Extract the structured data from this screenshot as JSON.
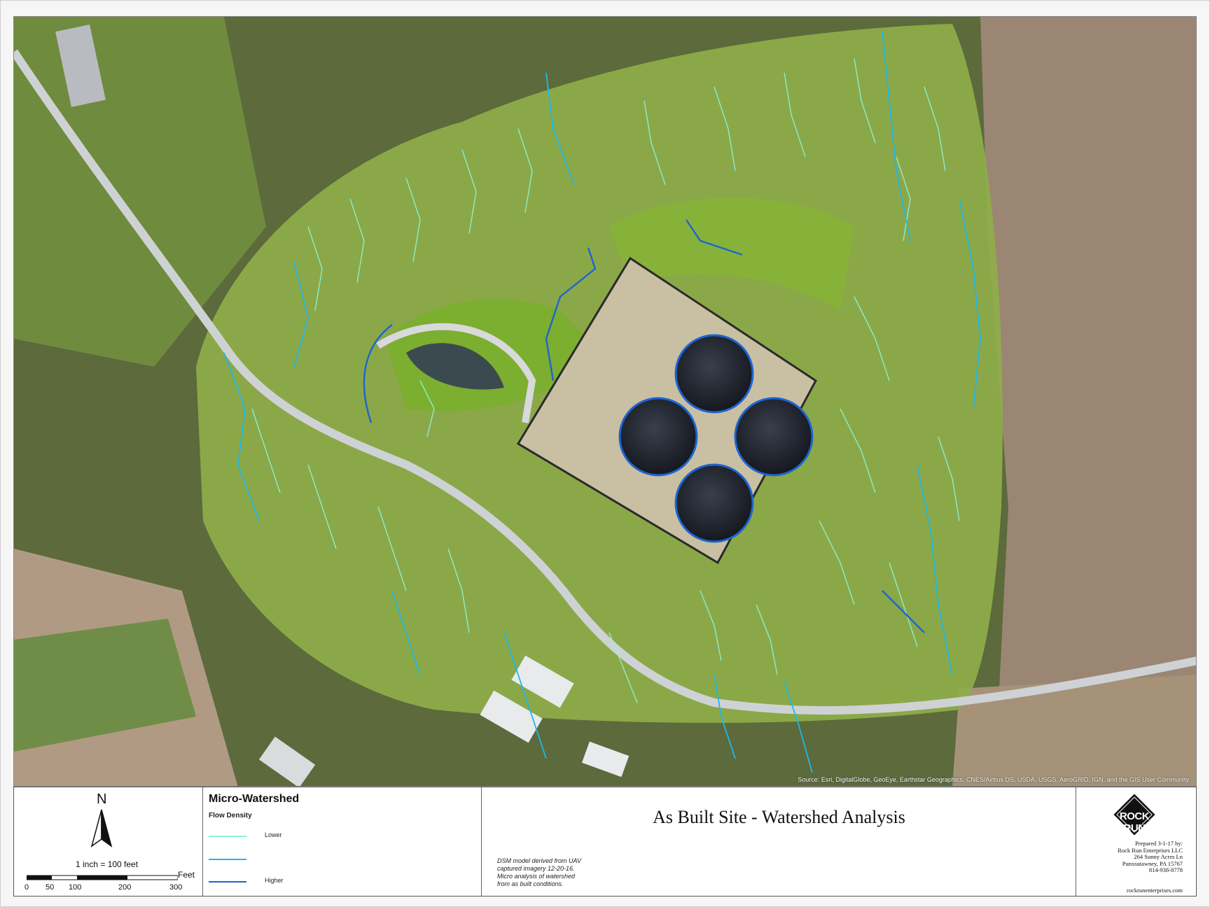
{
  "map": {
    "attribution": "Source: Esri, DigitalGlobe, GeoEye, Earthstar Geographics, CNES/Airbus DS, USDA, USGS, AeroGRID, IGN, and the GIS User Community",
    "colors": {
      "flow_lower": "#7fffd4",
      "flow_mid": "#1fb8e8",
      "flow_higher": "#1e64d2",
      "tank": "#20242e",
      "road": "#cfd2d4",
      "field": "#b8a694",
      "grass": "#7fa63c"
    }
  },
  "north_arrow": {
    "label": "N",
    "icon": "north-arrow-icon"
  },
  "scale": {
    "text": "1 inch = 100 feet",
    "unit": "Feet",
    "ticks": [
      "0",
      "50",
      "100",
      "200",
      "300"
    ]
  },
  "legend": {
    "title": "Micro-Watershed",
    "subtitle": "Flow Density",
    "items": [
      {
        "label": "Lower",
        "color": "#8af5da"
      },
      {
        "label": "",
        "color": "#1fb8e8"
      },
      {
        "label": "Higher",
        "color": "#1e64d2"
      }
    ]
  },
  "title_block": {
    "title": "As Built Site - Watershed Analysis",
    "note_line1": "DSM model derived from UAV",
    "note_line2": "captured imagery 12-20-16.",
    "note_line3": "Micro analysis of watershed",
    "note_line4": "from as built conditions."
  },
  "company": {
    "logo": "ROCK RUN",
    "prepared": "Prepared 3-1-17 by:",
    "name": "Rock Run Enterprises LLC",
    "address1": "264 Sunny Acres Ln",
    "address2": "Punxsutawney, PA 15767",
    "phone": "814-938-8778",
    "website": "rockrunenterprises.com"
  }
}
